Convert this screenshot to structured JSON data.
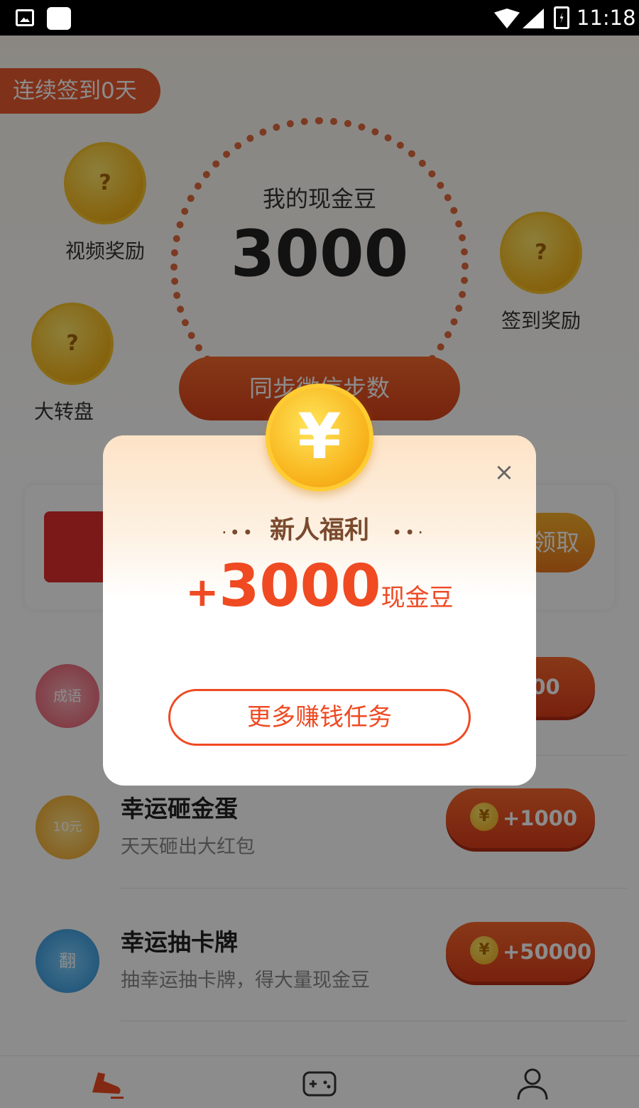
{
  "status_bar": {
    "time": "11:18"
  },
  "header": {
    "streak_label": "连续签到0天"
  },
  "hero": {
    "balance_label": "我的现金豆",
    "balance_value": "3000",
    "sync_button": "同步微信步数"
  },
  "coins": [
    {
      "symbol": "?",
      "label": "视频奖励"
    },
    {
      "symbol": "?",
      "label": "签到奖励"
    },
    {
      "symbol": "?",
      "label": "大转盘"
    }
  ],
  "gift_card": {
    "button_label": "领取"
  },
  "tasks": [
    {
      "title": "",
      "subtitle": "",
      "icon_text": "成语",
      "reward": "0000"
    },
    {
      "title": "幸运砸金蛋",
      "subtitle": "天天砸出大红包",
      "icon_text": "10元",
      "reward": "+1000"
    },
    {
      "title": "幸运抽卡牌",
      "subtitle": "抽幸运抽卡牌，得大量现金豆",
      "icon_text": "翻",
      "reward": "+50000"
    }
  ],
  "tabs": [
    {
      "name": "steps",
      "icon": "shoe-icon"
    },
    {
      "name": "games",
      "icon": "gamepad-icon"
    },
    {
      "name": "profile",
      "icon": "person-icon"
    }
  ],
  "dialog": {
    "title": "新人福利",
    "coin_symbol": "¥",
    "amount_plus": "+",
    "amount": "3000",
    "amount_unit": "现金豆",
    "more_button": "更多赚钱任务",
    "close_symbol": "×"
  },
  "colors": {
    "accent": "#ef4a22",
    "coin": "#f8b41c",
    "title_brown": "#7a4a2e"
  }
}
